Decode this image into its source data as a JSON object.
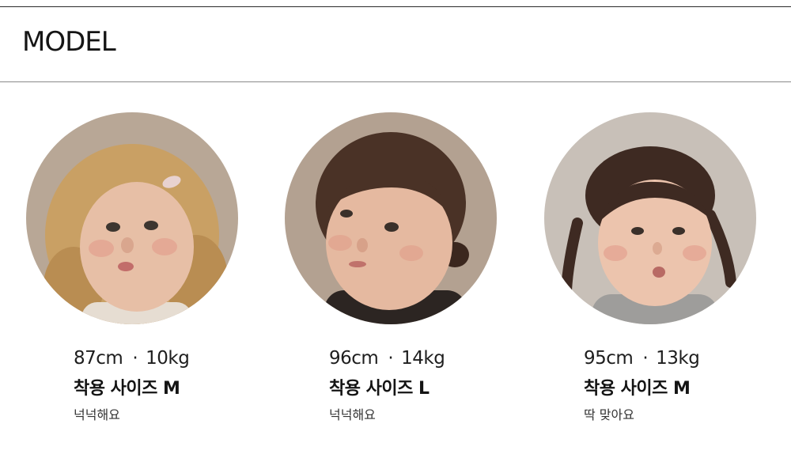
{
  "header": {
    "title": "MODEL"
  },
  "models": [
    {
      "height": "87cm",
      "separator": "·",
      "weight": "10kg",
      "size_label": "착용 사이즈 M",
      "fit_note": "넉넉해요",
      "hair_color": "#c9a064",
      "skin_color": "#e7bfa6",
      "bg_color": "#b8a796",
      "shirt_color": "#e6ddd2"
    },
    {
      "height": "96cm",
      "separator": "·",
      "weight": "14kg",
      "size_label": "착용 사이즈 L",
      "fit_note": "넉넉해요",
      "hair_color": "#4a3226",
      "skin_color": "#e5b9a0",
      "bg_color": "#b3a191",
      "shirt_color": "#2c2522"
    },
    {
      "height": "95cm",
      "separator": "·",
      "weight": "13kg",
      "size_label": "착용 사이즈 M",
      "fit_note": "딱 맞아요",
      "hair_color": "#3e2a22",
      "skin_color": "#ecc4ad",
      "bg_color": "#c8c0b8",
      "shirt_color": "#9e9d9b"
    }
  ]
}
